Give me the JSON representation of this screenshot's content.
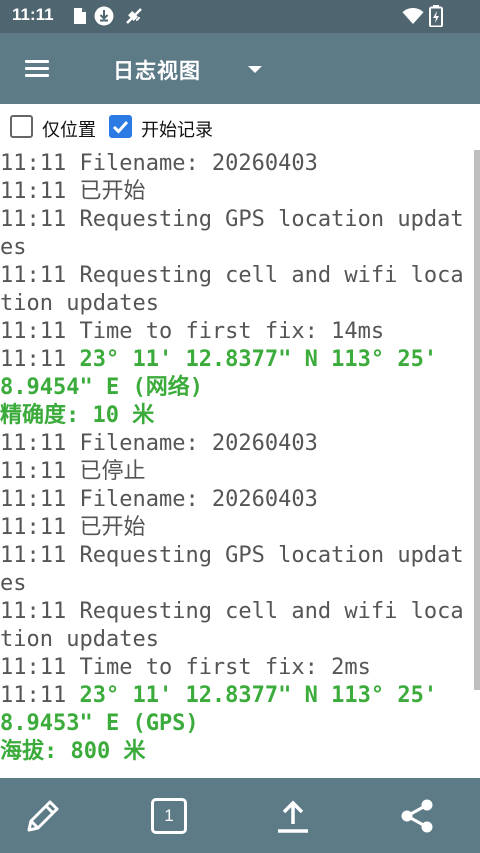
{
  "status_bar": {
    "time": "11:11",
    "icons": [
      "document-icon",
      "download-icon",
      "satellite-icon",
      "wifi-icon",
      "battery-charging-icon"
    ]
  },
  "toolbar": {
    "title": "日志视图",
    "menu_icon": "menu-icon",
    "dropdown_icon": "dropdown-caret-icon"
  },
  "checkboxes": [
    {
      "label": "仅位置",
      "checked": false
    },
    {
      "label": "开始记录",
      "checked": true
    }
  ],
  "log": [
    {
      "time": "11:11",
      "text": "Filename: 20260403"
    },
    {
      "time": "11:11",
      "text": "已开始"
    },
    {
      "time": "11:11",
      "text": "Requesting GPS location updates"
    },
    {
      "time": "11:11",
      "text": "Requesting cell and wifi location updates"
    },
    {
      "time": "11:11",
      "text": "Time to first fix: 14ms"
    },
    {
      "time": "11:11",
      "highlight": "23° 11' 12.8377\" N 113° 25' 8.9454\" E (网络)"
    },
    {
      "highlight": "精确度: 10 米"
    },
    {
      "time": "11:11",
      "text": "Filename: 20260403"
    },
    {
      "time": "11:11",
      "text": "已停止"
    },
    {
      "time": "11:11",
      "text": "Filename: 20260403"
    },
    {
      "time": "11:11",
      "text": "已开始"
    },
    {
      "time": "11:11",
      "text": "Requesting GPS location updates"
    },
    {
      "time": "11:11",
      "text": "Requesting cell and wifi location updates"
    },
    {
      "time": "11:11",
      "text": "Time to first fix: 2ms"
    },
    {
      "time": "11:11",
      "highlight": "23° 11' 12.8377\" N 113° 25' 8.9453\" E (GPS)"
    },
    {
      "highlight": "海拔: 800 米"
    }
  ],
  "bottom_bar": {
    "annotate_icon": "pencil-icon",
    "counter": "1",
    "upload_icon": "upload-icon",
    "share_icon": "share-icon"
  },
  "colors": {
    "statusbar": "#4f6670",
    "toolbar": "#5d7a87",
    "checkbox_checked": "#2c7be5",
    "log_text": "#555555",
    "log_highlight": "#3bab3b"
  }
}
